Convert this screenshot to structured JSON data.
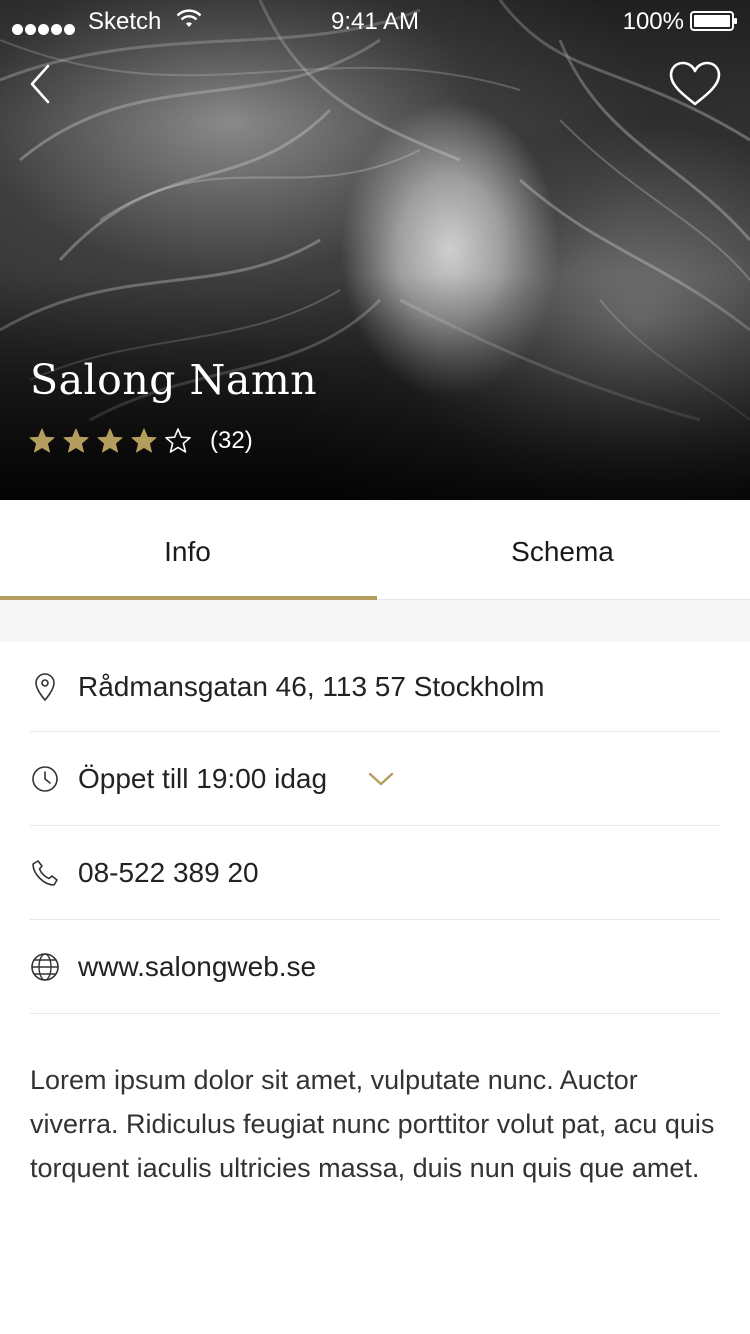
{
  "status_bar": {
    "carrier": "Sketch",
    "time": "9:41 AM",
    "battery": "100%"
  },
  "header": {
    "back_icon": "chevron-left-icon",
    "favorite_icon": "heart-outline-icon"
  },
  "salon": {
    "name": "Salong Namn",
    "rating": 4,
    "rating_max": 5,
    "review_count": "(32)"
  },
  "tabs": [
    {
      "label": "Info",
      "active": true
    },
    {
      "label": "Schema",
      "active": false
    }
  ],
  "info": {
    "address": "Rådmansgatan 46, 113 57 Stockholm",
    "hours": "Öppet till 19:00 idag",
    "phone": "08-522 389 20",
    "website": "www.salongweb.se"
  },
  "description": "Lorem ipsum dolor sit amet, vulputate nunc. Auctor viverra. Ridiculus feugiat nunc porttitor volut pat, acu quis torquent iaculis ultricies massa, duis nun quis que amet.",
  "colors": {
    "accent": "#b59d5f",
    "star": "#b59d5f",
    "text": "#222222"
  }
}
